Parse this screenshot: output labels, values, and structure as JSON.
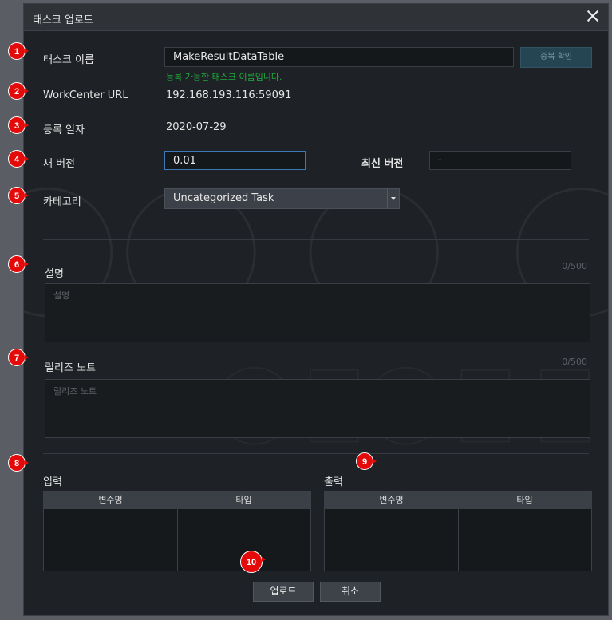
{
  "dialog": {
    "title": "태스크 업로드"
  },
  "fields": {
    "task_name_label": "태스크 이름",
    "task_name_value": "MakeResultDataTable",
    "duplicate_check_button": "중복 확인",
    "name_available_message": "등록 가능한 태스크 이름입니다.",
    "workcenter_url_label": "WorkCenter URL",
    "workcenter_url_value": "192.168.193.116:59091",
    "register_date_label": "등록 일자",
    "register_date_value": "2020-07-29",
    "new_version_label": "새 버전",
    "new_version_value": "0.01",
    "latest_version_label": "최신 버전",
    "latest_version_value": "-",
    "category_label": "카테고리",
    "category_selected": "Uncategorized Task"
  },
  "description": {
    "label": "설명",
    "counter": "0/500",
    "placeholder": "설명"
  },
  "release_notes": {
    "label": "릴리즈 노트",
    "counter": "0/500",
    "placeholder": "릴리즈 노트"
  },
  "input_table": {
    "label": "입력",
    "columns": [
      "변수명",
      "타입"
    ]
  },
  "output_table": {
    "label": "출력",
    "columns": [
      "변수명",
      "타입"
    ]
  },
  "actions": {
    "upload_button": "업로드",
    "cancel_button": "취소"
  },
  "markers": [
    "1",
    "2",
    "3",
    "4",
    "5",
    "6",
    "7",
    "8",
    "9",
    "10"
  ],
  "colors": {
    "background": "#1e2125",
    "titlebar": "#2f3338",
    "success_text": "#1fae3c",
    "marker": "#e50a0a",
    "focus_border": "#3d78b8"
  }
}
